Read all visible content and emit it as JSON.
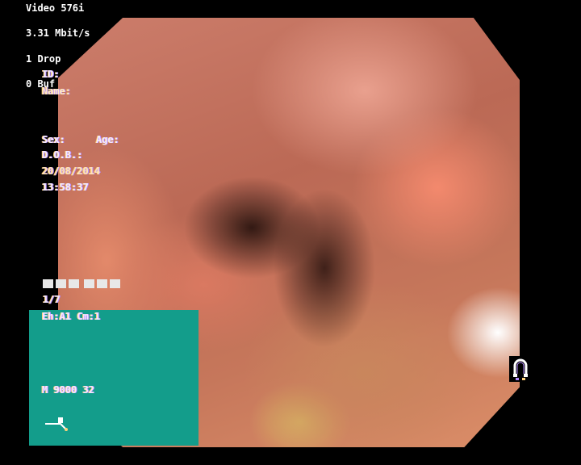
{
  "overlay": {
    "video_mode": "Video 576i",
    "bitrate": "3.31 Mbit/s",
    "drop": "1 Drop",
    "buffer": "0 Buf"
  },
  "patient": {
    "id_label": "ID:",
    "name_label": "Name:",
    "sex_label": "Sex:",
    "age_label": "Age:",
    "dob_label": "D.O.B.:",
    "date": "20/08/2014",
    "time": "13:58:37"
  },
  "panel": {
    "counter": "1/7",
    "settings": "Eh:A1 Cm:1",
    "mode": "M 9000 32"
  },
  "icons": {
    "magnet": "magnet-icon",
    "scope_tool": "scope-tool-icon"
  },
  "colors": {
    "panel_green": "#139d8b",
    "background": "#000000"
  }
}
